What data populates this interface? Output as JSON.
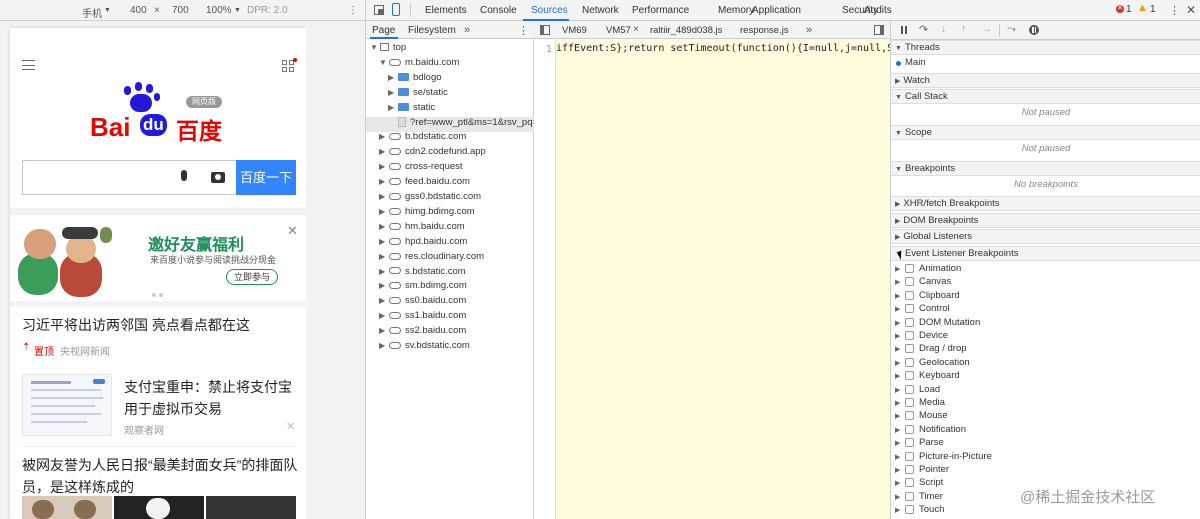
{
  "device_bar": {
    "device": "手机",
    "width": "400",
    "times": "×",
    "height": "700",
    "zoom": "100%",
    "dpr": "DPR: 2.0"
  },
  "phone": {
    "logo": {
      "bai": "Bai",
      "du": "du",
      "baidu_cn": "百度",
      "badge": "网页版"
    },
    "search_button": "百度一下",
    "ad": {
      "title": "邀好友赢福利",
      "subtitle": "来百度小说参与阅读挑战分现金",
      "button": "立即参与"
    },
    "news": [
      {
        "title": "习近平将出访两邻国 亮点看点都在这",
        "tag": "置顶",
        "source": "央视网新闻"
      },
      {
        "title": "支付宝重申：禁止将支付宝用于虚拟币交易",
        "source": "观察者网"
      },
      {
        "title": "被网友誉为人民日报“最美封面女兵”的排面队员，是这样炼成的"
      }
    ]
  },
  "devtools_tabs": [
    "Elements",
    "Console",
    "Sources",
    "Network",
    "Performance",
    "Memory",
    "Application",
    "Security",
    "Audits"
  ],
  "active_tab": "Sources",
  "error_count": "1",
  "warning_count": "1",
  "navigator": {
    "tabs": [
      "Page",
      "Filesystem"
    ],
    "more": "»",
    "tree": [
      {
        "label": "top",
        "level": 0,
        "kind": "folder-open"
      },
      {
        "label": "m.baidu.com",
        "level": 1,
        "kind": "cloud-open"
      },
      {
        "label": "bdlogo",
        "level": 2,
        "kind": "folder"
      },
      {
        "label": "se/static",
        "level": 2,
        "kind": "folder"
      },
      {
        "label": "static",
        "level": 2,
        "kind": "folder"
      },
      {
        "label": "?ref=www_ptl&ms=1&rsv_pq=",
        "level": 2,
        "kind": "file"
      },
      {
        "label": "b.bdstatic.com",
        "level": 1,
        "kind": "cloud"
      },
      {
        "label": "cdn2.codefund.app",
        "level": 1,
        "kind": "cloud"
      },
      {
        "label": "cross-request",
        "level": 1,
        "kind": "cloud"
      },
      {
        "label": "feed.baidu.com",
        "level": 1,
        "kind": "cloud"
      },
      {
        "label": "gss0.bdstatic.com",
        "level": 1,
        "kind": "cloud"
      },
      {
        "label": "himg.bdimg.com",
        "level": 1,
        "kind": "cloud"
      },
      {
        "label": "hm.baidu.com",
        "level": 1,
        "kind": "cloud"
      },
      {
        "label": "hpd.baidu.com",
        "level": 1,
        "kind": "cloud"
      },
      {
        "label": "res.cloudinary.com",
        "level": 1,
        "kind": "cloud"
      },
      {
        "label": "s.bdstatic.com",
        "level": 1,
        "kind": "cloud"
      },
      {
        "label": "sm.bdimg.com",
        "level": 1,
        "kind": "cloud"
      },
      {
        "label": "ss0.baidu.com",
        "level": 1,
        "kind": "cloud"
      },
      {
        "label": "ss1.baidu.com",
        "level": 1,
        "kind": "cloud"
      },
      {
        "label": "ss2.baidu.com",
        "level": 1,
        "kind": "cloud"
      },
      {
        "label": "sv.bdstatic.com",
        "level": 1,
        "kind": "cloud"
      }
    ]
  },
  "editor": {
    "tabs": [
      "VM69",
      "VM57",
      "raltiir_489d038.js",
      "response.js"
    ],
    "active_tab": "VM57",
    "more": "»",
    "line_number": "1",
    "code": "iffEvent:S};return setTimeout(function(){I=null,j=null,S=null}"
  },
  "debugger": {
    "sections": [
      {
        "title": "Threads",
        "expanded": true,
        "content": "Main"
      },
      {
        "title": "Watch",
        "expanded": false
      },
      {
        "title": "Call Stack",
        "expanded": true,
        "note": "Not paused"
      },
      {
        "title": "Scope",
        "expanded": true,
        "note": "Not paused"
      },
      {
        "title": "Breakpoints",
        "expanded": true,
        "note": "No breakpoints"
      },
      {
        "title": "XHR/fetch Breakpoints",
        "expanded": false
      },
      {
        "title": "DOM Breakpoints",
        "expanded": false
      },
      {
        "title": "Global Listeners",
        "expanded": false
      },
      {
        "title": "Event Listener Breakpoints",
        "expanded": true
      }
    ],
    "event_listeners": [
      "Animation",
      "Canvas",
      "Clipboard",
      "Control",
      "DOM Mutation",
      "Device",
      "Drag / drop",
      "Geolocation",
      "Keyboard",
      "Load",
      "Media",
      "Mouse",
      "Notification",
      "Parse",
      "Picture-in-Picture",
      "Pointer",
      "Script",
      "Timer",
      "Touch"
    ]
  },
  "watermark": "@稀土掘金技术社区",
  "colors": {
    "accent": "#1a73e8",
    "baidu_red": "#e10602",
    "baidu_blue": "#2319dc",
    "search_btn": "#3385ff",
    "editor_bg": "#fffbdd",
    "error": "#d93025",
    "warning": "#f29900"
  }
}
